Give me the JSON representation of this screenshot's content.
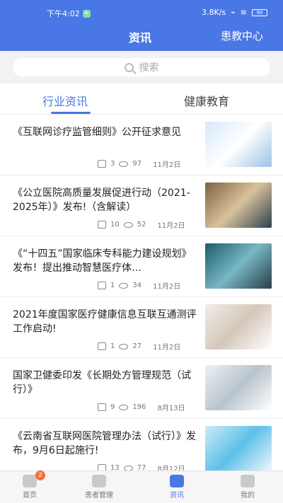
{
  "status": {
    "time": "下午4:02",
    "network": "3.8K/s",
    "battery": "90"
  },
  "nav": {
    "title": "资讯",
    "right": "患教中心"
  },
  "search": {
    "placeholder": "搜索"
  },
  "tabs": [
    {
      "label": "行业资讯"
    },
    {
      "label": "健康教育"
    }
  ],
  "articles": [
    {
      "title": "《互联网诊疗监管细则》公开征求意见",
      "likes": "3",
      "views": "97",
      "date": "11月2日"
    },
    {
      "title": "《公立医院高质量发展促进行动（2021-2025年）》发布!（含解读）",
      "likes": "10",
      "views": "52",
      "date": "11月2日"
    },
    {
      "title": "《“十四五”国家临床专科能力建设规划》发布！提出推动智慧医疗体…",
      "likes": "1",
      "views": "34",
      "date": "11月2日"
    },
    {
      "title": "2021年度国家医疗健康信息互联互通测评工作启动!",
      "likes": "1",
      "views": "27",
      "date": "11月2日"
    },
    {
      "title": "国家卫健委印发《长期处方管理规范（试行）》",
      "likes": "9",
      "views": "196",
      "date": "8月13日"
    },
    {
      "title": "《云南省互联网医院管理办法（试行）》发布，9月6日起施行!",
      "likes": "13",
      "views": "77",
      "date": "8月12日"
    }
  ],
  "bottom_nav": [
    {
      "label": "首页",
      "badge": "2"
    },
    {
      "label": "患者管理"
    },
    {
      "label": "资讯"
    },
    {
      "label": "我的"
    }
  ]
}
